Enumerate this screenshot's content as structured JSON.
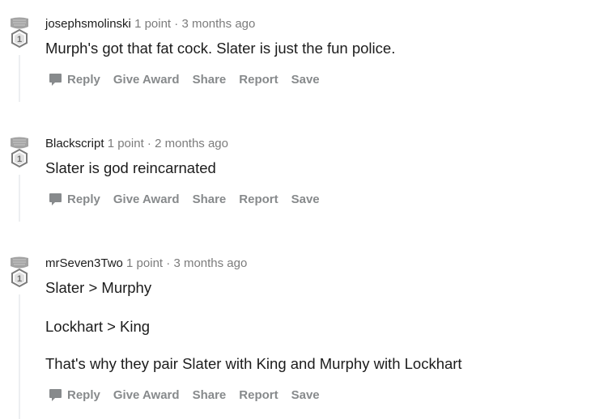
{
  "comments": [
    {
      "author": "josephsmolinski",
      "points": "1 point",
      "separator": "·",
      "time": "3 months ago",
      "badge_number": "1",
      "paragraphs": [
        "Murph's got that fat cock. Slater is just the fun police."
      ]
    },
    {
      "author": "Blackscript",
      "points": "1 point",
      "separator": "·",
      "time": "2 months ago",
      "badge_number": "1",
      "paragraphs": [
        "Slater is god reincarnated"
      ]
    },
    {
      "author": "mrSeven3Two",
      "points": "1 point",
      "separator": "·",
      "time": "3 months ago",
      "badge_number": "1",
      "paragraphs": [
        "Slater > Murphy",
        "Lockhart > King",
        "That's why they pair Slater with King and Murphy with Lockhart"
      ]
    }
  ],
  "actions": {
    "reply": "Reply",
    "give_award": "Give Award",
    "share": "Share",
    "report": "Report",
    "save": "Save"
  },
  "colors": {
    "meta_gray": "#7c7c7c",
    "action_gray": "#878a8c",
    "badge_silver": "#9a9a9a",
    "thread_line": "#edeff1",
    "text": "#1c1c1c"
  },
  "icons": {
    "avatar": "karma-badge-icon",
    "reply": "comment-bubble-icon"
  }
}
